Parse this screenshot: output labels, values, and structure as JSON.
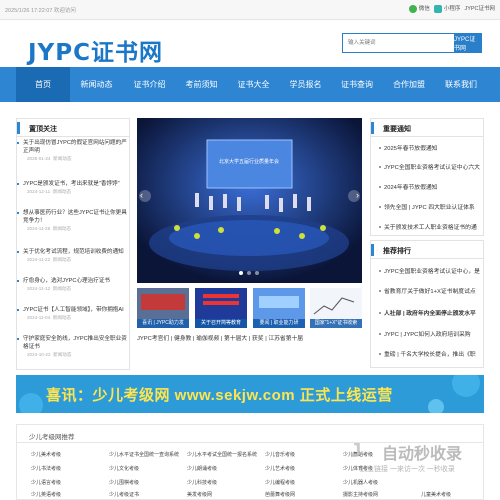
{
  "topbar": {
    "datetime": "2025/1/26 17:22:07 欢迎访问",
    "wechat": "微信",
    "mini": "小程序",
    "site": "JYPC证书网"
  },
  "header": {
    "logo_text": "JYPC证书网",
    "search_placeholder": "输入关键词",
    "search_button": "JYPC证书网"
  },
  "nav": [
    "首页",
    "新闻动态",
    "证书介绍",
    "考前须知",
    "证书大全",
    "学员报名",
    "证书查询",
    "合作加盟",
    "联系我们"
  ],
  "left_panel": {
    "title": "置顶关注",
    "items": [
      {
        "title": "关于出现仿冒JYPC的假证官网站问题的严正声明",
        "date": "2025-01-24",
        "tag": "新闻动态"
      },
      {
        "title": "JYPC是颁发证书，考出来就是\"香饽饽\"",
        "date": "2024-12-11",
        "tag": "新闻动态"
      },
      {
        "title": "想从事医药行业？这些JYPC证书让你更具竞争力！",
        "date": "2024-11-28",
        "tag": "新闻动态"
      },
      {
        "title": "关于优化考试流程，规范培训收费的通知",
        "date": "2024-11-22",
        "tag": "新闻动态"
      },
      {
        "title": "疗愈身心，选对JYPC心理治疗证书",
        "date": "2024-11-12",
        "tag": "新闻动态"
      },
      {
        "title": "JYPC证书【人工智能领域】，带你拥抱AI",
        "date": "2024-11-04",
        "tag": "新闻动态"
      },
      {
        "title": "守护家庭安全防线，JYPC推出安全职业资格证书",
        "date": "2024-10-22",
        "tag": "新闻动态"
      }
    ]
  },
  "banner": {
    "stage_text": "北京大学五届行业质量年会"
  },
  "thumbs": [
    {
      "caption": "喜讯 | JYPC助力发"
    },
    {
      "caption": "关于召开简等教育"
    },
    {
      "caption": "要闻 | 职业能力研"
    },
    {
      "caption": "国家\"1+X\"证书收索"
    }
  ],
  "tags": [
    "JYPC考官们",
    "健身教",
    "瑜伽视频",
    "第十届大",
    "获奖",
    "江苏省第十届"
  ],
  "right_top": {
    "title": "重要通知",
    "items": [
      "2025年春节放假通知",
      "JYPC全国职业资格考试认证中心六大",
      "2024年春节放假通知",
      "领先全国 | JYPC 四大职业认证体系",
      "关于颁发技术工人职业资格证书的通"
    ]
  },
  "right_bottom": {
    "title": "推荐排行",
    "items": [
      "JYPC全国职业资格考试认证中心，是",
      "省教育厅关于做好1+X证书制度试点",
      "人社部 | 政府年内全面停止颁发水平",
      "JYPC | JYPC如何入政府培训采购",
      "重磅 | 千名大学校长提合，推出《职"
    ]
  },
  "ad": {
    "text": "喜讯：少儿考级网 www.sekjw.com 正式上线运营"
  },
  "links": {
    "title": "少儿考级网推荐",
    "items": [
      "少儿美术考级",
      "少儿水平证书全国统一查询系统",
      "少儿水平考试全国统一报名系统",
      "少儿音乐考级",
      "少儿舞蹈考级",
      "少儿书法考级",
      "少儿文化考级",
      "少儿朗诵考级",
      "少儿艺术考级",
      "少儿体育考级",
      "少儿语言考级",
      "少儿围棋考级",
      "少儿科技考级",
      "少儿编程考级",
      "少儿机器人考级",
      "少儿英语考级",
      "少儿考级证书",
      "美发考级网",
      "芭蕾舞考级网",
      "摄影主持考级网",
      "儿童美术考级"
    ]
  },
  "watermark": {
    "big": "自动秒收录",
    "small": "放上链接 一来访一次 一秒收录"
  }
}
